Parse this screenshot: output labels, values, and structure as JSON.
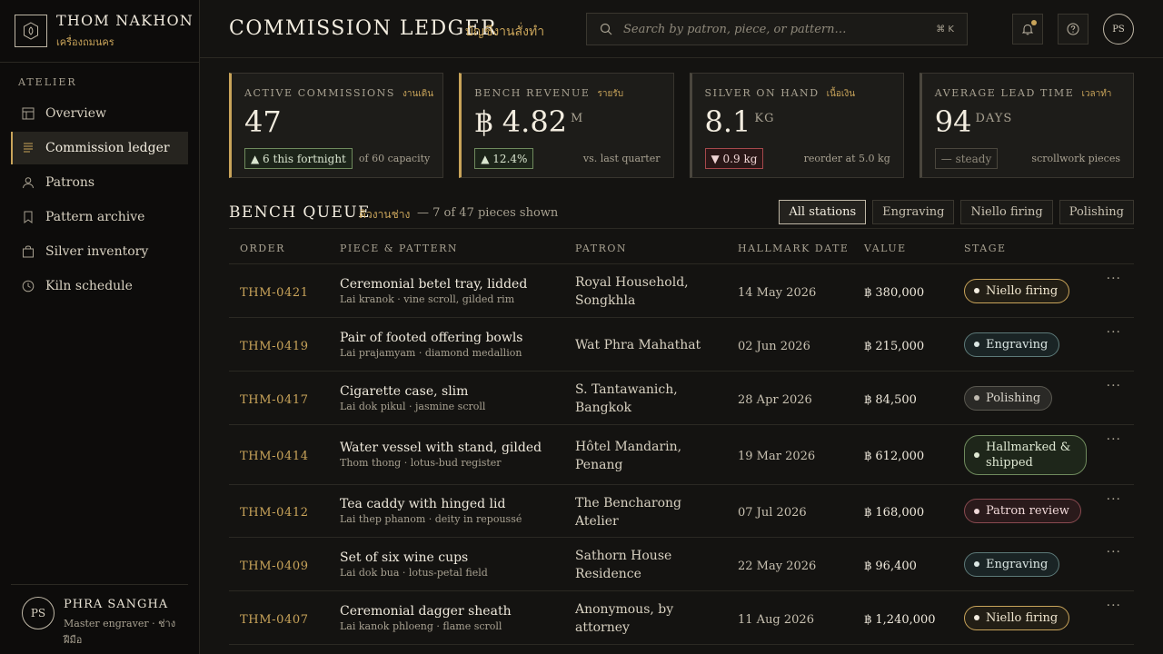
{
  "brand": {
    "name": "THOM NAKHON",
    "sub": "เครื่องถมนคร"
  },
  "sidebar": {
    "section": "ATELIER",
    "items": [
      {
        "label": "Overview",
        "icon": "layout-icon"
      },
      {
        "label": "Commission ledger",
        "icon": "ledger-icon"
      },
      {
        "label": "Patrons",
        "icon": "user-icon"
      },
      {
        "label": "Pattern archive",
        "icon": "bookmark-icon"
      },
      {
        "label": "Silver inventory",
        "icon": "bag-icon"
      },
      {
        "label": "Kiln schedule",
        "icon": "clock-icon"
      }
    ],
    "active_index": 1
  },
  "user": {
    "initials": "PS",
    "name": "PHRA SANGHA",
    "role": "Master engraver · ช่างฝีมือ"
  },
  "header": {
    "title": "COMMISSION LEDGER",
    "title_th": "บัญชีงานสั่งทำ",
    "search_placeholder": "Search by patron, piece, or pattern…",
    "search_shortcut": "⌘ K",
    "avatar": "PS"
  },
  "stats": [
    {
      "label": "ACTIVE COMMISSIONS",
      "label_th": "งานเดิน",
      "value": "47",
      "unit": "",
      "delta": "▲ 6 this fortnight",
      "delta_type": "up",
      "note": "of 60 capacity"
    },
    {
      "label": "BENCH REVENUE",
      "label_th": "รายรับ",
      "value": "฿ 4.82",
      "unit": "M",
      "delta": "▲ 12.4%",
      "delta_type": "up",
      "note": "vs. last quarter"
    },
    {
      "label": "SILVER ON HAND",
      "label_th": "เนื้อเงิน",
      "value": "8.1",
      "unit": "KG",
      "delta": "▼ 0.9 kg",
      "delta_type": "down",
      "note": "reorder at 5.0 kg"
    },
    {
      "label": "AVERAGE LEAD TIME",
      "label_th": "เวลาทำ",
      "value": "94",
      "unit": "DAYS",
      "delta": "— steady",
      "delta_type": "flat",
      "note": "scrollwork pieces"
    }
  ],
  "queue": {
    "title": "BENCH QUEUE",
    "title_th": "คิวงานช่าง",
    "count": "— 7 of 47 pieces shown",
    "filters": [
      "All stations",
      "Engraving",
      "Niello firing",
      "Polishing"
    ],
    "active_filter": 0
  },
  "table": {
    "columns": [
      "ORDER",
      "PIECE & PATTERN",
      "PATRON",
      "HALLMARK DATE",
      "VALUE",
      "STAGE"
    ],
    "rows": [
      {
        "order": "THM-0421",
        "piece": "Ceremonial betel tray, lidded",
        "pattern": "Lai kranok · vine scroll, gilded rim",
        "patron": "Royal Household, Songkhla",
        "date": "14 May 2026",
        "value": "฿ 380,000",
        "stage": "Niello firing",
        "stage_type": "niello"
      },
      {
        "order": "THM-0419",
        "piece": "Pair of footed offering bowls",
        "pattern": "Lai prajamyam · diamond medallion",
        "patron": "Wat Phra Mahathat",
        "date": "02 Jun 2026",
        "value": "฿ 215,000",
        "stage": "Engraving",
        "stage_type": "engraving"
      },
      {
        "order": "THM-0417",
        "piece": "Cigarette case, slim",
        "pattern": "Lai dok pikul · jasmine scroll",
        "patron": "S. Tantawanich, Bangkok",
        "date": "28 Apr 2026",
        "value": "฿ 84,500",
        "stage": "Polishing",
        "stage_type": "polishing"
      },
      {
        "order": "THM-0414",
        "piece": "Water vessel with stand, gilded",
        "pattern": "Thom thong · lotus-bud register",
        "patron": "Hôtel Mandarin, Penang",
        "date": "19 Mar 2026",
        "value": "฿ 612,000",
        "stage": "Hallmarked & shipped",
        "stage_type": "shipped"
      },
      {
        "order": "THM-0412",
        "piece": "Tea caddy with hinged lid",
        "pattern": "Lai thep phanom · deity in repoussé",
        "patron": "The Bencharong Atelier",
        "date": "07 Jul 2026",
        "value": "฿ 168,000",
        "stage": "Patron review",
        "stage_type": "review"
      },
      {
        "order": "THM-0409",
        "piece": "Set of six wine cups",
        "pattern": "Lai dok bua · lotus-petal field",
        "patron": "Sathorn House Residence",
        "date": "22 May 2026",
        "value": "฿ 96,400",
        "stage": "Engraving",
        "stage_type": "engraving"
      },
      {
        "order": "THM-0407",
        "piece": "Ceremonial dagger sheath",
        "pattern": "Lai kanok phloeng · flame scroll",
        "patron": "Anonymous, by attorney",
        "date": "11 Aug 2026",
        "value": "฿ 1,240,000",
        "stage": "Niello firing",
        "stage_type": "niello"
      }
    ],
    "more_label": "···"
  },
  "colors": {
    "accent": "#c9a45a",
    "background": "#141311",
    "sidebar": "#0d0c0b"
  }
}
